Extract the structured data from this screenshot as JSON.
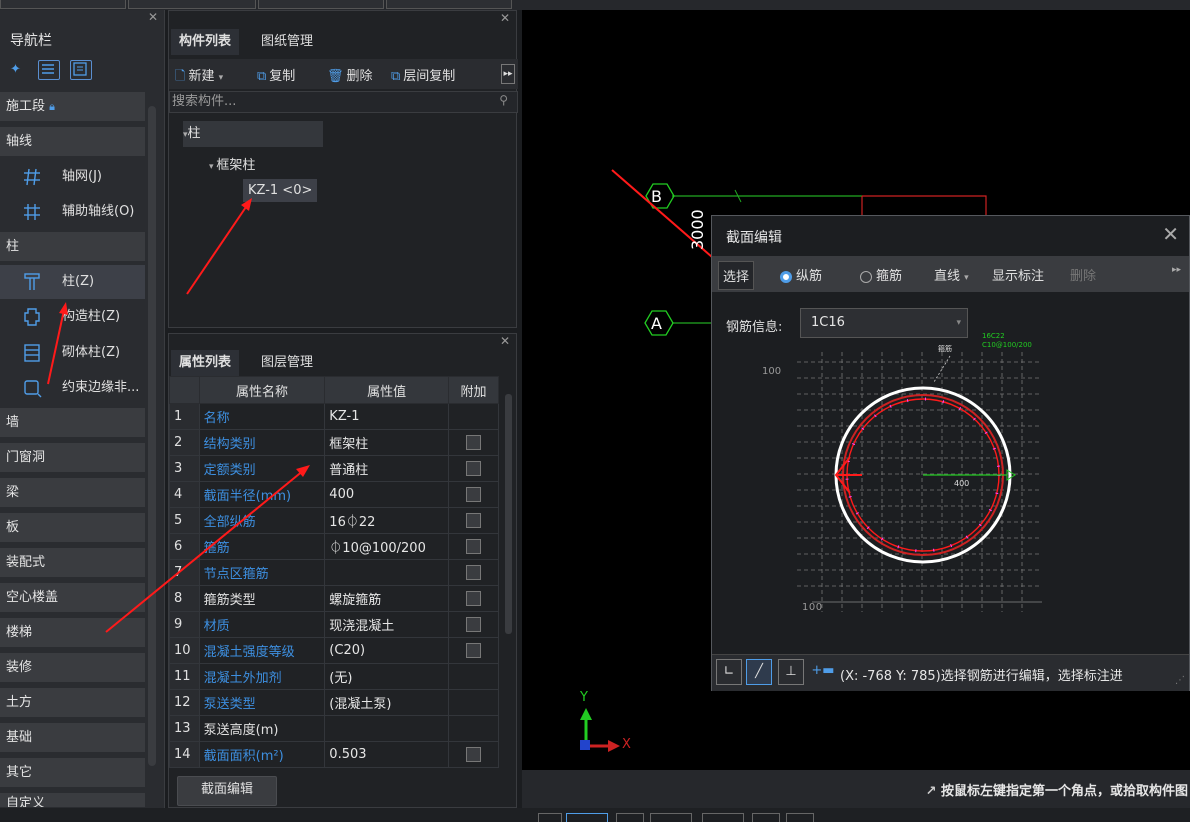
{
  "nav": {
    "title": "导航栏",
    "sections": {
      "construction": "施工段",
      "axis": "轴线",
      "column": "柱",
      "wall": "墙",
      "door_window": "门窗洞",
      "beam": "梁",
      "slab": "板",
      "prefab": "装配式",
      "hollow": "空心楼盖",
      "stair": "楼梯",
      "decoration": "装修",
      "earthwork": "土方",
      "foundation": "基础",
      "other": "其它",
      "custom": "自定义"
    },
    "items": {
      "grid": "轴网(J)",
      "aux_axis": "辅助轴线(O)",
      "col": "柱(Z)",
      "struct_col": "构造柱(Z)",
      "masonry_col": "砌体柱(Z)",
      "edge_member": "约束边缘非..."
    }
  },
  "complist": {
    "tabs": [
      "构件列表",
      "图纸管理"
    ],
    "toolbar": {
      "new": "新建",
      "copy": "复制",
      "delete": "删除",
      "floor_copy": "层间复制"
    },
    "search_placeholder": "搜索构件...",
    "tree": {
      "root": "柱",
      "child": "框架柱",
      "leaf": "KZ-1 <0>"
    }
  },
  "props": {
    "tabs": [
      "属性列表",
      "图层管理"
    ],
    "headers": {
      "name": "属性名称",
      "value": "属性值",
      "extra": "附加"
    },
    "rows": [
      {
        "n": "1",
        "name": "名称",
        "value": "KZ-1"
      },
      {
        "n": "2",
        "name": "结构类别",
        "value": "框架柱"
      },
      {
        "n": "3",
        "name": "定额类别",
        "value": "普通柱"
      },
      {
        "n": "4",
        "name": "截面半径(mm)",
        "value": "400"
      },
      {
        "n": "5",
        "name": "全部纵筋",
        "value": "16⏀22"
      },
      {
        "n": "6",
        "name": "箍筋",
        "value": "⏀10@100/200"
      },
      {
        "n": "7",
        "name": "节点区箍筋",
        "value": ""
      },
      {
        "n": "8",
        "name": "箍筋类型",
        "value": "螺旋箍筋"
      },
      {
        "n": "9",
        "name": "材质",
        "value": "现浇混凝土"
      },
      {
        "n": "10",
        "name": "混凝土强度等级",
        "value": "(C20)"
      },
      {
        "n": "11",
        "name": "混凝土外加剂",
        "value": "(无)"
      },
      {
        "n": "12",
        "name": "泵送类型",
        "value": "(混凝土泵)"
      },
      {
        "n": "13",
        "name": "泵送高度(m)",
        "value": ""
      },
      {
        "n": "14",
        "name": "截面面积(m²)",
        "value": "0.503"
      }
    ],
    "section_edit_button": "截面编辑"
  },
  "canvas": {
    "axis_b": "B",
    "axis_a": "A",
    "dim_3000": "3000",
    "axis_y": "Y",
    "axis_x": "X",
    "status": "按鼠标左键指定第一个角点，或拾取构件图"
  },
  "dialog": {
    "title": "截面编辑",
    "toolbar": {
      "select": "选择",
      "longitudinal": "纵筋",
      "stirrup": "箍筋",
      "line": "直线",
      "show_dim": "显示标注",
      "delete": "删除"
    },
    "rebar_label": "钢筋信息:",
    "rebar_value": "1C16",
    "drawing": {
      "ann1": "16C22",
      "ann2": "C10@100/200",
      "ann3": "箍筋",
      "grid_label": "100",
      "radius_label": "400"
    },
    "status": "(X: -768 Y: 785)选择钢筋进行编辑，选择标注进"
  },
  "colors": {
    "accent": "#4f9de8",
    "prop_name": "#3d8fe0",
    "annotation_red": "#ff1a1a",
    "axis_green": "#22cc22"
  }
}
